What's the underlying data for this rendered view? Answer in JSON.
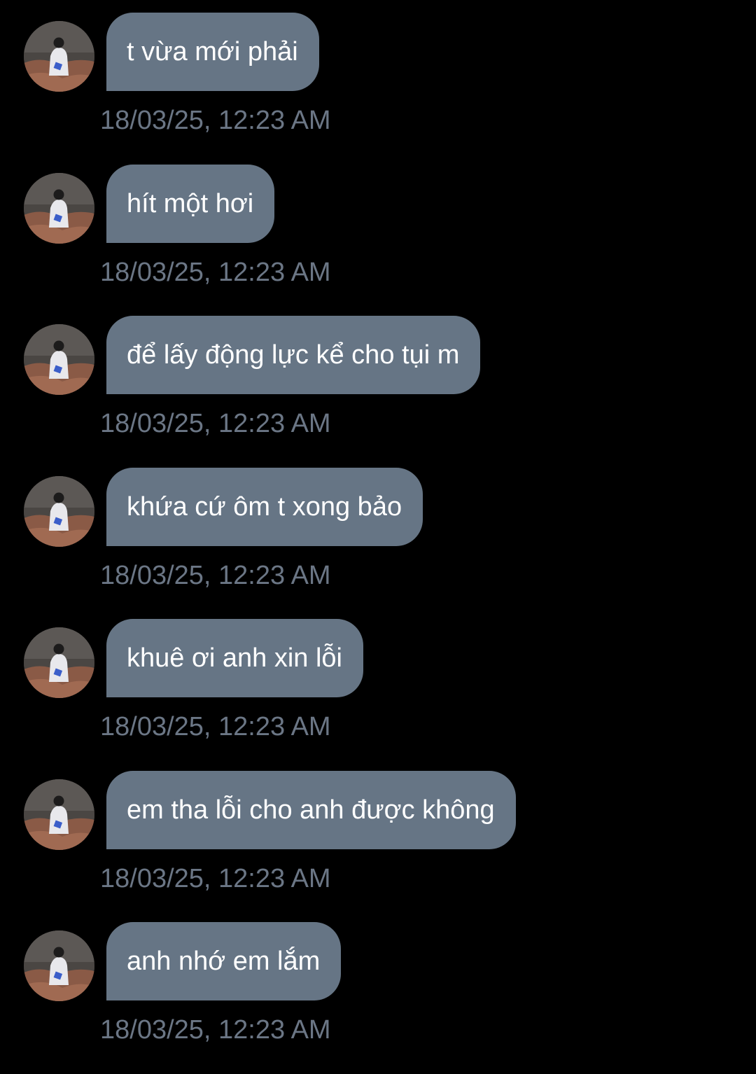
{
  "colors": {
    "background": "#000000",
    "bubble": "#667585",
    "bubble_text": "#ffffff",
    "timestamp": "#6b7685"
  },
  "messages": [
    {
      "text": "t vừa mới phải",
      "time": "18/03/25, 12:23 AM",
      "avatar": "profile-photo"
    },
    {
      "text": "hít một hơi",
      "time": "18/03/25, 12:23 AM",
      "avatar": "profile-photo"
    },
    {
      "text": "để lấy động lực kể cho tụi m",
      "time": "18/03/25, 12:23 AM",
      "avatar": "profile-photo"
    },
    {
      "text": "khứa cứ ôm t xong bảo",
      "time": "18/03/25, 12:23 AM",
      "avatar": "profile-photo"
    },
    {
      "text": "khuê ơi anh xin lỗi",
      "time": "18/03/25, 12:23 AM",
      "avatar": "profile-photo"
    },
    {
      "text": "em tha lỗi cho anh được không",
      "time": "18/03/25, 12:23 AM",
      "avatar": "profile-photo"
    },
    {
      "text": "anh nhớ em lắm",
      "time": "18/03/25, 12:23 AM",
      "avatar": "profile-photo"
    }
  ]
}
